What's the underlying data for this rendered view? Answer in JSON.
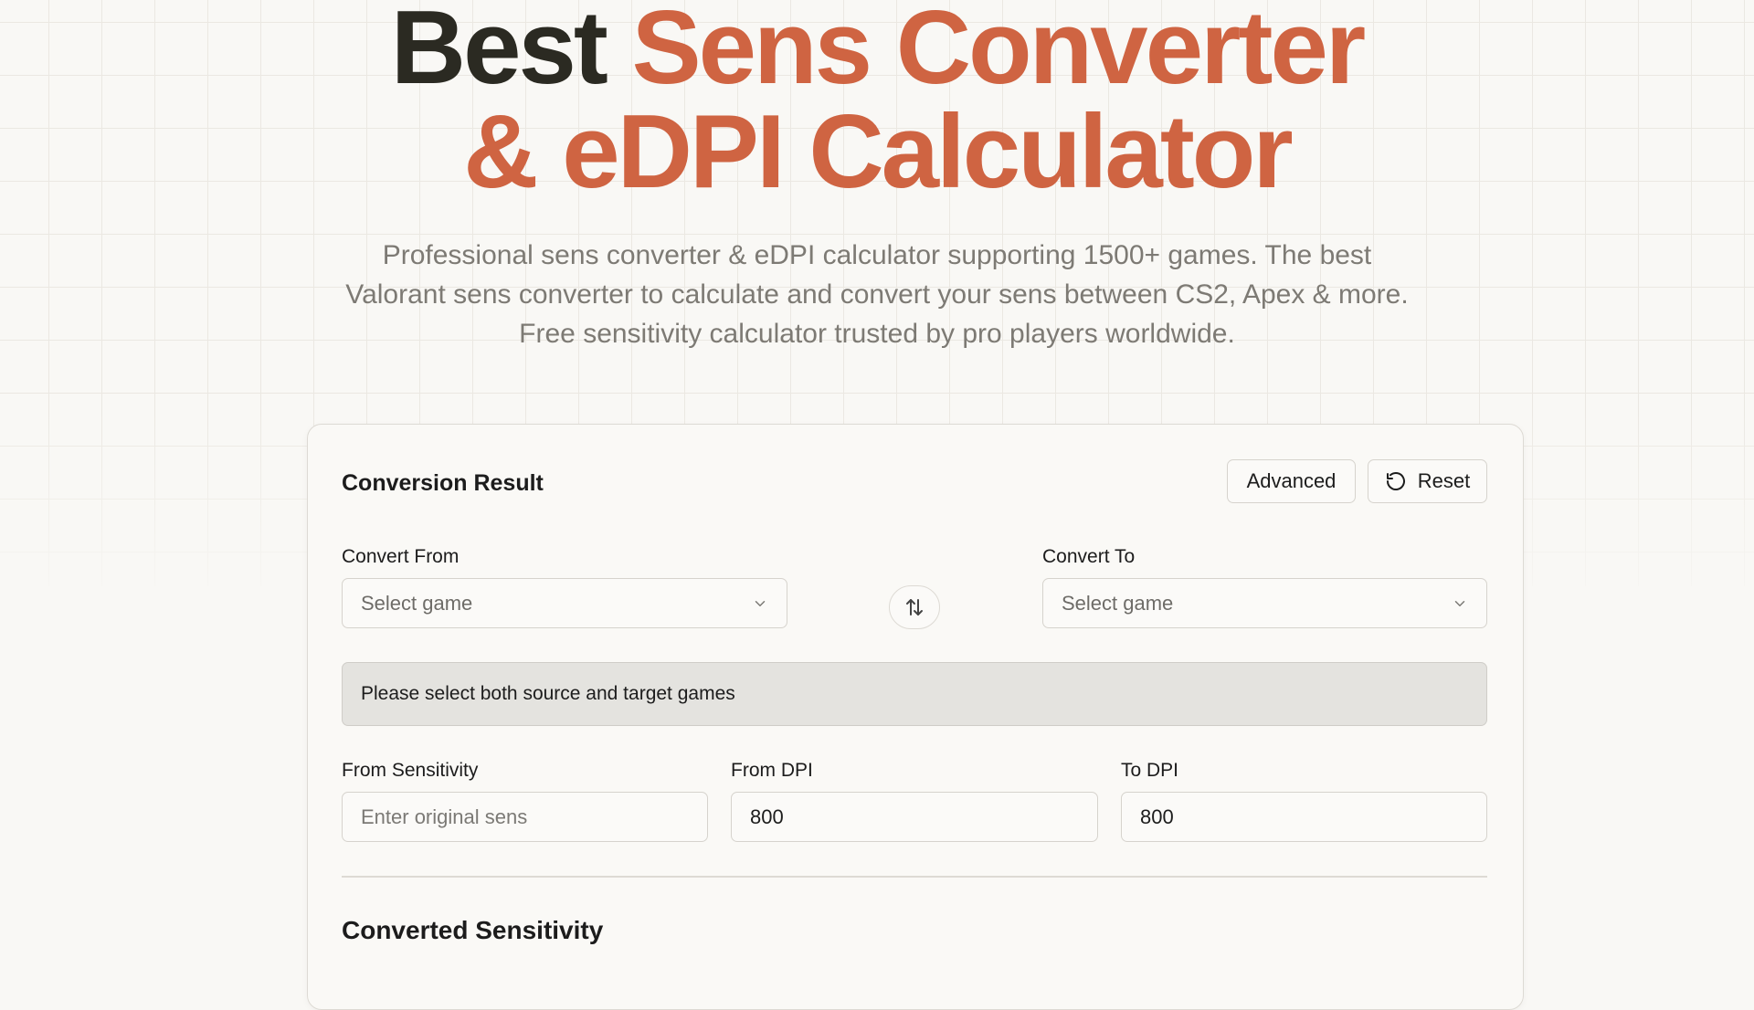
{
  "hero": {
    "title_line1_dark": "Best",
    "title_line1_accent": "Sens Converter",
    "title_line2_accent": "& eDPI Calculator",
    "subtitle": "Professional sens converter & eDPI calculator supporting 1500+ games. The best Valorant sens converter to calculate and convert your sens between CS2, Apex & more. Free sensitivity calculator trusted by pro players worldwide."
  },
  "card": {
    "title": "Conversion Result",
    "advanced_label": "Advanced",
    "reset_label": "Reset",
    "convert_from": {
      "label": "Convert From",
      "placeholder": "Select game"
    },
    "convert_to": {
      "label": "Convert To",
      "placeholder": "Select game"
    },
    "status_message": "Please select both source and target games",
    "from_sensitivity": {
      "label": "From Sensitivity",
      "placeholder": "Enter original sens",
      "value": ""
    },
    "from_dpi": {
      "label": "From DPI",
      "value": "800"
    },
    "to_dpi": {
      "label": "To DPI",
      "value": "800"
    },
    "converted_title": "Converted Sensitivity"
  },
  "colors": {
    "accent": "#cf6442",
    "dark_heading": "#2b2a22",
    "background": "#f9f8f5",
    "status_bg": "#e4e3df"
  },
  "icons": {
    "reset": "rotate-ccw-icon",
    "swap": "swap-vertical-icon",
    "dropdown": "chevron-down-icon"
  }
}
